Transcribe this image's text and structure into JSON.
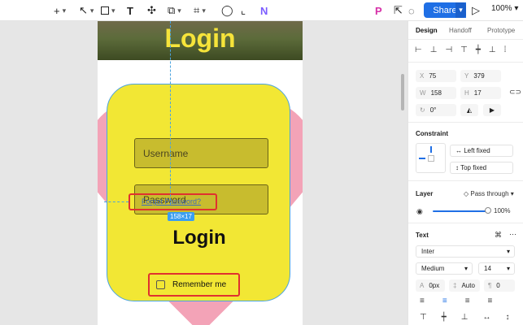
{
  "toolbar": {
    "share_label": "Share",
    "zoom": "100%"
  },
  "canvas": {
    "banner_title": "Login",
    "username_placeholder": "Username",
    "password_placeholder": "Password",
    "forgot_label": "Forgot Password?",
    "size_tag": "158×17",
    "card_title": "Login",
    "remember_label": "Remember me"
  },
  "panel": {
    "tabs": [
      "Design",
      "Handoff",
      "Prototype"
    ],
    "x_label": "X",
    "x_value": "75",
    "y_label": "Y",
    "y_value": "379",
    "w_label": "W",
    "w_value": "158",
    "h_label": "H",
    "h_value": "17",
    "rotation": "0°",
    "constraint_title": "Constraint",
    "constraint_h": "Left fixed",
    "constraint_v": "Top fixed",
    "layer_title": "Layer",
    "layer_mode": "Pass through",
    "opacity": "100%",
    "text_title": "Text",
    "font": "Inter",
    "weight": "Medium",
    "size": "14",
    "letter_spacing": "0px",
    "line_height": "Auto",
    "paragraph": "0"
  },
  "colors": {
    "accent": "#1f6fe5",
    "card": "#f2e734",
    "heart": "#f3a3b7",
    "selection": "#e0312f"
  }
}
